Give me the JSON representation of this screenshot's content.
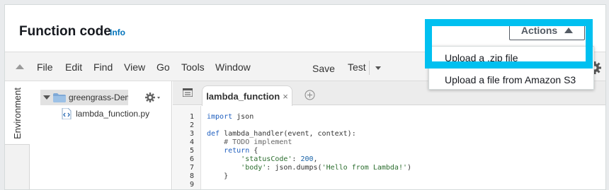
{
  "header": {
    "title": "Function code",
    "info_link": "Info",
    "actions_label": "Actions"
  },
  "toolbar": {
    "menu": [
      "File",
      "Edit",
      "Find",
      "View",
      "Go",
      "Tools",
      "Window"
    ],
    "save_label": "Save",
    "test_label": "Test"
  },
  "sidebar": {
    "environment_tab": "Environment"
  },
  "tree": {
    "folder_name": "greengrass-Demo-l",
    "file_name": "lambda_function.py"
  },
  "editor": {
    "tab_label": "lambda_function",
    "tab_close": "×",
    "line_numbers": [
      "1",
      "2",
      "3",
      "4",
      "5",
      "6",
      "7",
      "8",
      "9"
    ]
  },
  "dropdown": {
    "items": [
      "Upload a .zip file",
      "Upload a file from Amazon S3"
    ]
  },
  "colors": {
    "highlight": "#00c0f0",
    "info_link": "#0073bb"
  }
}
